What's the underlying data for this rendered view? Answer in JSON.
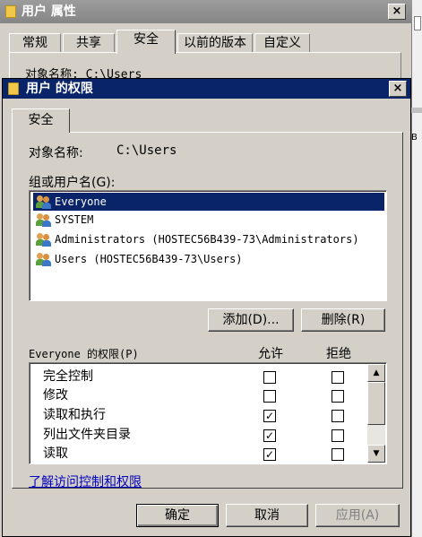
{
  "background_window": {
    "title": "用户 属性",
    "close": "×",
    "tabs": [
      {
        "label": "常规",
        "selected": false
      },
      {
        "label": "共享",
        "selected": false
      },
      {
        "label": "安全",
        "selected": true
      },
      {
        "label": "以前的版本",
        "selected": false
      },
      {
        "label": "自定义",
        "selected": false
      }
    ],
    "peek_text": "对象名称:    C:\\Users",
    "edge_char": "B"
  },
  "dialog": {
    "title": "用户 的权限",
    "close": "×",
    "tab": "安全",
    "object_label": "对象名称:",
    "object_value": "C:\\Users",
    "group_label": "组或用户名(G):",
    "users": [
      {
        "name": "Everyone",
        "selected": true
      },
      {
        "name": "SYSTEM",
        "selected": false
      },
      {
        "name": "Administrators (HOSTEC56B439-73\\Administrators)",
        "selected": false
      },
      {
        "name": "Users (HOSTEC56B439-73\\Users)",
        "selected": false
      }
    ],
    "add_button": "添加(D)...",
    "remove_button": "删除(R)",
    "perm_title": "Everyone 的权限(P)",
    "allow_header": "允许",
    "deny_header": "拒绝",
    "permissions": [
      {
        "name": "完全控制",
        "allow": false,
        "deny": false
      },
      {
        "name": "修改",
        "allow": false,
        "deny": false
      },
      {
        "name": "读取和执行",
        "allow": true,
        "deny": false
      },
      {
        "name": "列出文件夹目录",
        "allow": true,
        "deny": false
      },
      {
        "name": "读取",
        "allow": true,
        "deny": false
      }
    ],
    "learn_link": "了解访问控制和权限",
    "ok_button": "确定",
    "cancel_button": "取消",
    "apply_button": "应用(A)"
  },
  "colors": {
    "title_active": "#0a246a",
    "title_inactive": "#8e8e8e",
    "face": "#d4d0c8",
    "link": "#0000c0"
  }
}
